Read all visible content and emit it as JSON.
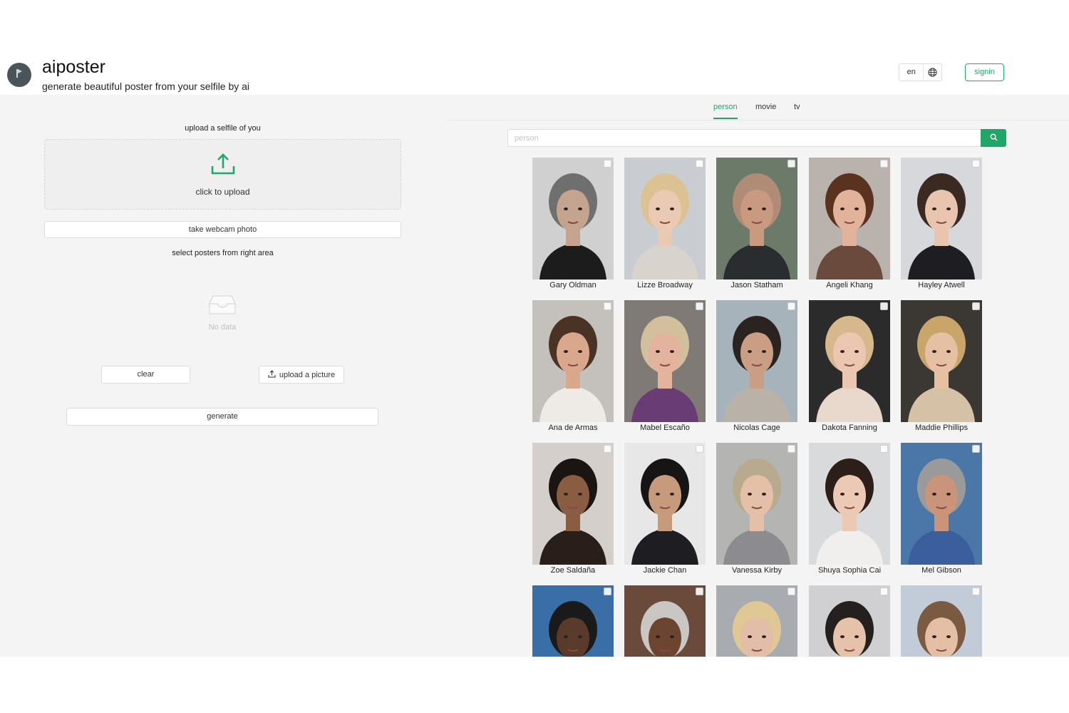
{
  "header": {
    "app_title": "aiposter",
    "app_subtitle": "generate beautiful poster from your selfile by ai",
    "language": "en",
    "signin_label": "signin"
  },
  "left_panel": {
    "upload_heading": "upload a selfile of you",
    "upload_zone_label": "click to upload",
    "webcam_button": "take webcam photo",
    "select_posters_label": "select posters from right area",
    "empty_text": "No data",
    "clear_button": "clear",
    "upload_picture_button": "upload a picture",
    "generate_button": "generate"
  },
  "right_panel": {
    "tabs": [
      {
        "label": "person",
        "active": true
      },
      {
        "label": "movie",
        "active": false
      },
      {
        "label": "tv",
        "active": false
      }
    ],
    "search_placeholder": "person",
    "people": [
      {
        "name": "Gary Oldman",
        "bg": "#cfd0cf",
        "skin": "#c4a38f",
        "hair": "#6f6f6f",
        "cloth": "#1c1c1c"
      },
      {
        "name": "Lizze Broadway",
        "bg": "#c9ccd0",
        "skin": "#ebcab4",
        "hair": "#dcc293",
        "cloth": "#d9d3ce"
      },
      {
        "name": "Jason Statham",
        "bg": "#6c7a6a",
        "skin": "#c99a80",
        "hair": "#b08c77",
        "cloth": "#2a2d30"
      },
      {
        "name": "Angeli Khang",
        "bg": "#b9b2ad",
        "skin": "#e2b39a",
        "hair": "#5a3220",
        "cloth": "#6a4a3c"
      },
      {
        "name": "Hayley Atwell",
        "bg": "#d6d8db",
        "skin": "#e9c5b0",
        "hair": "#3a2a22",
        "cloth": "#1d1d22"
      },
      {
        "name": "Ana de Armas",
        "bg": "#c4c0bc",
        "skin": "#d9a88c",
        "hair": "#4a3324",
        "cloth": "#eeeae6"
      },
      {
        "name": "Mabel Escaño",
        "bg": "#7f7a76",
        "skin": "#e4b39e",
        "hair": "#d2bf9c",
        "cloth": "#6a3c76"
      },
      {
        "name": "Nicolas Cage",
        "bg": "#a7b3bb",
        "skin": "#c99e84",
        "hair": "#2a231f",
        "cloth": "#b8b2a8"
      },
      {
        "name": "Dakota Fanning",
        "bg": "#2b2b2b",
        "skin": "#ebc7b2",
        "hair": "#d7b88c",
        "cloth": "#e8d9cc"
      },
      {
        "name": "Maddie Phillips",
        "bg": "#3b3834",
        "skin": "#e6c0a2",
        "hair": "#c9a56a",
        "cloth": "#d5c2a6"
      },
      {
        "name": "Zoe Saldaña",
        "bg": "#d4cfca",
        "skin": "#8a5c42",
        "hair": "#1a1412",
        "cloth": "#2a1e1a"
      },
      {
        "name": "Jackie Chan",
        "bg": "#e7e7e7",
        "skin": "#c79a7c",
        "hair": "#161414",
        "cloth": "#1e1e22"
      },
      {
        "name": "Vanessa Kirby",
        "bg": "#b4b4b2",
        "skin": "#e4c0a8",
        "hair": "#b8aa8e",
        "cloth": "#8c8c90"
      },
      {
        "name": "Shuya Sophia Cai",
        "bg": "#d8dadc",
        "skin": "#ecc9b4",
        "hair": "#2c1e18",
        "cloth": "#f1eeee"
      },
      {
        "name": "Mel Gibson",
        "bg": "#4b77a8",
        "skin": "#c99479",
        "hair": "#9a9a9a",
        "cloth": "#3b5f9c"
      },
      {
        "name": "",
        "bg": "#3a6ea6",
        "skin": "#5a3a2a",
        "hair": "#1a1a1a",
        "cloth": "#1f1f1f"
      },
      {
        "name": "",
        "bg": "#6a4a3a",
        "skin": "#6c4530",
        "hair": "#c9c6c4",
        "cloth": "#2a2420"
      },
      {
        "name": "",
        "bg": "#a8acb0",
        "skin": "#e2bda7",
        "hair": "#e0c894",
        "cloth": "#b8b8b8"
      },
      {
        "name": "",
        "bg": "#d0d0d2",
        "skin": "#e6c2aa",
        "hair": "#24201e",
        "cloth": "#2e2e30"
      },
      {
        "name": "",
        "bg": "#c2ccd8",
        "skin": "#e4bfa6",
        "hair": "#7a5a40",
        "cloth": "#c8ccd2"
      }
    ]
  },
  "colors": {
    "accent": "#1fa76a",
    "panel_bg": "#f4f4f4"
  }
}
